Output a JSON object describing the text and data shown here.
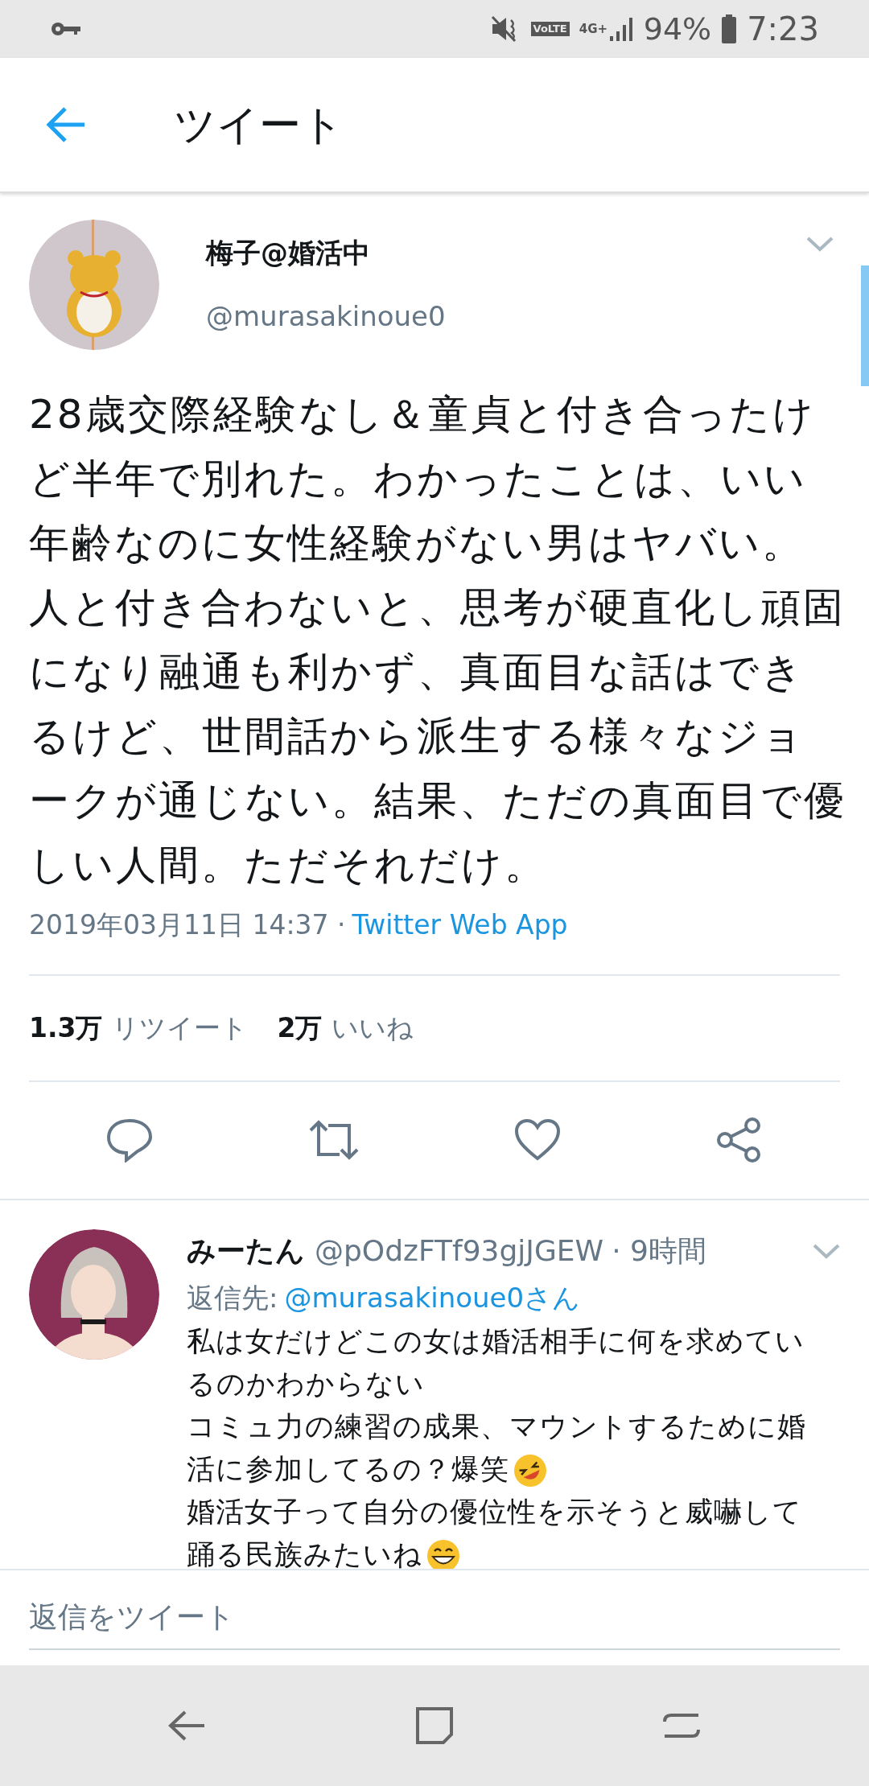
{
  "status_bar": {
    "battery": "94%",
    "time": "7:23",
    "network": "4G+",
    "volte": "VoLTE"
  },
  "header": {
    "title": "ツイート"
  },
  "tweet": {
    "name": "梅子@婚活中",
    "handle": "@murasakinoue0",
    "text": "28歳交際経験なし＆童貞と付き合ったけど半年で別れた。わかったことは、いい年齢なのに女性経験がない男はヤバい。人と付き合わないと、思考が硬直化し頑固になり融通も利かず、真面目な話はできるけど、世間話から派生する様々なジョークが通じない。結果、ただの真面目で優しい人間。ただそれだけ。",
    "date": "2019年03月11日 14:37 ·",
    "source": "Twitter Web App",
    "stats": [
      {
        "count": "1.3万",
        "label": "リツイート"
      },
      {
        "count": "2万",
        "label": "いいね"
      }
    ]
  },
  "reply": {
    "name": "みーたん",
    "handle": "@pOdzFTf93gjJGEW",
    "time": "· 9時間",
    "reply_to_label": "返信先:",
    "reply_to": "@murasakinoue0さん",
    "lines": [
      {
        "text": "私は女だけどこの女は婚活相手に何を求めているのかわからない",
        "kind": "plain"
      },
      {
        "text": "コミュ力の練習の成果、マウントするために婚活に参加してるの？爆笑",
        "kind": "laughing"
      },
      {
        "text": "婚活女子って自分の優位性を示そうと威嚇して踊る民族みたいね",
        "kind": "grinning"
      }
    ]
  },
  "reply_field": {
    "placeholder": "返信をツイート"
  }
}
